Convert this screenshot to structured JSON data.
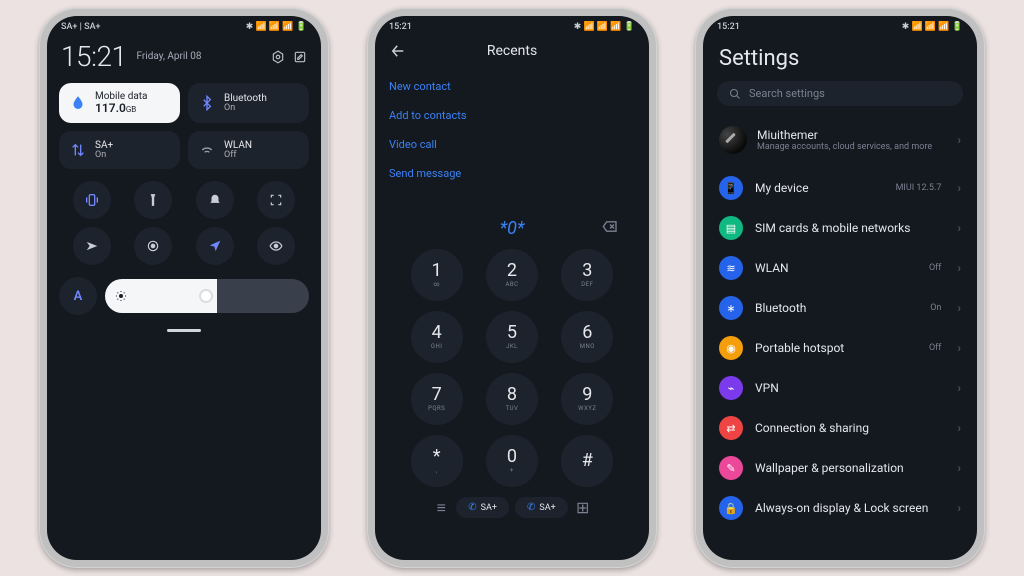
{
  "status": {
    "left": "SA+ | SA+",
    "time": "15:21"
  },
  "phone1": {
    "time": "15:21",
    "date": "Friday, April 08",
    "tiles": {
      "data_label": "Mobile data",
      "data_value": "117.0",
      "data_unit": "GB",
      "bluetooth_label": "Bluetooth",
      "bluetooth_state": "On",
      "sa_label": "SA+",
      "sa_state": "On",
      "wlan_label": "WLAN",
      "wlan_state": "Off"
    },
    "auto_letter": "A",
    "brightness_pct": 55
  },
  "phone2": {
    "title": "Recents",
    "links": {
      "new_contact": "New contact",
      "add_contacts": "Add to contacts",
      "video_call": "Video call",
      "send_message": "Send message"
    },
    "dialed": "*0*",
    "keys": [
      {
        "n": "1",
        "l": "∞"
      },
      {
        "n": "2",
        "l": "ABC"
      },
      {
        "n": "3",
        "l": "DEF"
      },
      {
        "n": "4",
        "l": "GHI"
      },
      {
        "n": "5",
        "l": "JKL"
      },
      {
        "n": "6",
        "l": "MNO"
      },
      {
        "n": "7",
        "l": "PQRS"
      },
      {
        "n": "8",
        "l": "TUV"
      },
      {
        "n": "9",
        "l": "WXYZ"
      },
      {
        "n": "*",
        "l": ","
      },
      {
        "n": "0",
        "l": "+"
      },
      {
        "n": "#",
        "l": ""
      }
    ],
    "sim1": "SA+",
    "sim2": "SA+"
  },
  "phone3": {
    "title": "Settings",
    "search_placeholder": "Search settings",
    "profile_name": "Miuithemer",
    "profile_sub": "Manage accounts, cloud services, and more",
    "items": [
      {
        "icon": "📱",
        "label": "My device",
        "state": "MIUI 12.5.7",
        "color": "c-blue"
      },
      {
        "icon": "▤",
        "label": "SIM cards & mobile networks",
        "state": "",
        "color": "c-green"
      },
      {
        "icon": "≋",
        "label": "WLAN",
        "state": "Off",
        "color": "c-blue"
      },
      {
        "icon": "∗",
        "label": "Bluetooth",
        "state": "On",
        "color": "c-blue"
      },
      {
        "icon": "◉",
        "label": "Portable hotspot",
        "state": "Off",
        "color": "c-orange"
      },
      {
        "icon": "⌁",
        "label": "VPN",
        "state": "",
        "color": "c-purple"
      },
      {
        "icon": "⇄",
        "label": "Connection & sharing",
        "state": "",
        "color": "c-red"
      },
      {
        "icon": "✎",
        "label": "Wallpaper & personalization",
        "state": "",
        "color": "c-pink"
      },
      {
        "icon": "🔒",
        "label": "Always-on display & Lock screen",
        "state": "",
        "color": "c-blue"
      }
    ]
  }
}
